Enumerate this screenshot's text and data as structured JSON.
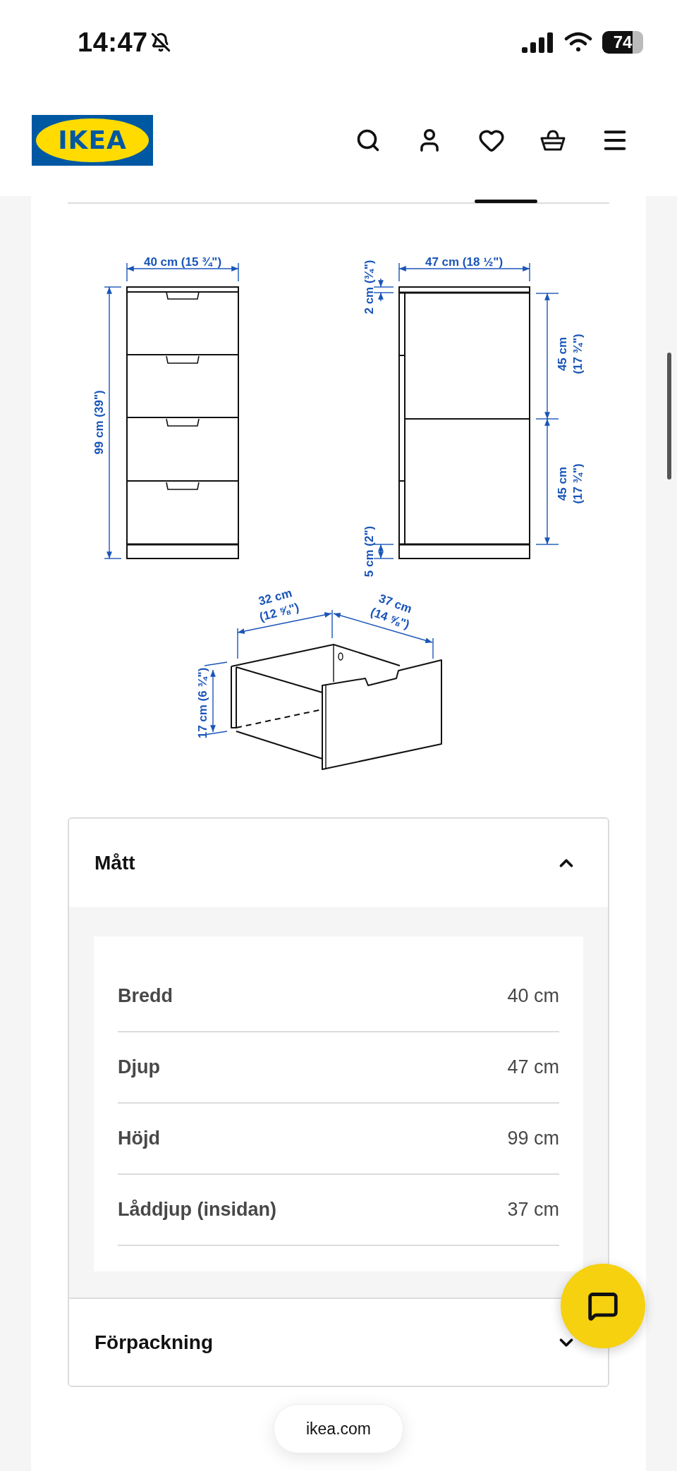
{
  "status_bar": {
    "time": "14:47",
    "battery": "74"
  },
  "header": {
    "logo": "IKEA"
  },
  "diagram": {
    "labels": [
      {
        "lines": [
          "40 cm (15 ¾\")"
        ]
      },
      {
        "lines": [
          "47 cm (18 ½\")"
        ]
      },
      {
        "lines": [
          "99 cm (39\")"
        ]
      },
      {
        "lines": [
          "2 cm (¾\")"
        ]
      },
      {
        "lines": [
          "45 cm",
          "(17 ¾\")"
        ]
      },
      {
        "lines": [
          "45 cm",
          "(17 ¾\")"
        ]
      },
      {
        "lines": [
          "5 cm (2\")"
        ]
      },
      {
        "lines": [
          "32 cm",
          "(12 ⅝\")"
        ]
      },
      {
        "lines": [
          "37 cm",
          "(14 ⅝\")"
        ]
      },
      {
        "lines": [
          "17 cm (6 ¾\")"
        ]
      }
    ]
  },
  "accordion": [
    {
      "title": "Mått",
      "expanded": true,
      "rows": [
        {
          "label": "Bredd",
          "value": "40 cm"
        },
        {
          "label": "Djup",
          "value": "47 cm"
        },
        {
          "label": "Höjd",
          "value": "99 cm"
        },
        {
          "label": "Låddjup (insidan)",
          "value": "37 cm"
        }
      ]
    },
    {
      "title": "Förpackning",
      "expanded": false
    }
  ],
  "footer": {
    "url": "ikea.com"
  }
}
